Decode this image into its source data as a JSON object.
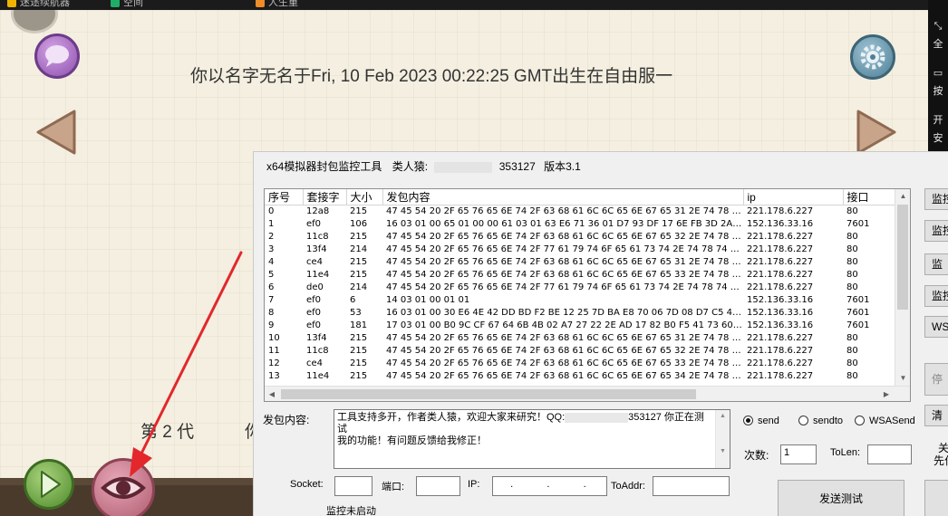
{
  "browser": {
    "tabs": [
      {
        "label": "迷途续航器",
        "color": "#f0b400"
      },
      {
        "label": "空间",
        "color": "#1fae65"
      },
      {
        "label": "人生重",
        "color": "#f08c2a"
      }
    ]
  },
  "right_sidebar": {
    "items": [
      "全",
      "按",
      "开",
      "安"
    ]
  },
  "game": {
    "headline": "你以名字无名于Fri, 10 Feb 2023 00:22:25 GMT出生在自由服一",
    "generation": "第 2 代",
    "generation_suffix": "你"
  },
  "tool": {
    "title_prefix": "x64模拟器封包监控工具",
    "author_label": "类人猿:",
    "author_suffix": "353127",
    "version": "版本3.1",
    "columns": [
      "序号",
      "套接字",
      "大小",
      "发包内容",
      "ip",
      "接口"
    ],
    "rows": [
      [
        "0",
        "12a8",
        "215",
        "47 45 54 20 2F 65 76 65 6E 74 2F 63 68 61 6C 6C 65 6E 67 65 31 2E 74 78 74...",
        "221.178.6.227",
        "80"
      ],
      [
        "1",
        "ef0",
        "106",
        "16 03 01 00 65 01 00 00 61 03 01 63 E6 71 36 01 D7 93 DF 17 6E FB 3D 2A 33...",
        "152.136.33.16",
        "7601"
      ],
      [
        "2",
        "11c8",
        "215",
        "47 45 54 20 2F 65 76 65 6E 74 2F 63 68 61 6C 6C 65 6E 67 65 32 2E 74 78 74...",
        "221.178.6.227",
        "80"
      ],
      [
        "3",
        "13f4",
        "214",
        "47 45 54 20 2F 65 76 65 6E 74 2F 77 61 79 74 6F 65 61 73 74 2E 74 78 74 20...",
        "221.178.6.227",
        "80"
      ],
      [
        "4",
        "ce4",
        "215",
        "47 45 54 20 2F 65 76 65 6E 74 2F 63 68 61 6C 6C 65 6E 67 65 31 2E 74 78 74...",
        "221.178.6.227",
        "80"
      ],
      [
        "5",
        "11e4",
        "215",
        "47 45 54 20 2F 65 76 65 6E 74 2F 63 68 61 6C 6C 65 6E 67 65 33 2E 74 78 74...",
        "221.178.6.227",
        "80"
      ],
      [
        "6",
        "de0",
        "214",
        "47 45 54 20 2F 65 76 65 6E 74 2F 77 61 79 74 6F 65 61 73 74 2E 74 78 74 20...",
        "221.178.6.227",
        "80"
      ],
      [
        "7",
        "ef0",
        "6",
        "14 03 01 00 01 01",
        "152.136.33.16",
        "7601"
      ],
      [
        "8",
        "ef0",
        "53",
        "16 03 01 00 30 E6 4E 42 DD BD F2 BE 12 25 7D BA E8 70 06 7D 08 D7 C5 47 E...",
        "152.136.33.16",
        "7601"
      ],
      [
        "9",
        "ef0",
        "181",
        "17 03 01 00 B0 9C CF 67 64 6B 4B 02 A7 27 22 2E AD 17 82 B0 F5 41 73 60 7...",
        "152.136.33.16",
        "7601"
      ],
      [
        "10",
        "13f4",
        "215",
        "47 45 54 20 2F 65 76 65 6E 74 2F 63 68 61 6C 6C 65 6E 67 65 31 2E 74 78 74...",
        "221.178.6.227",
        "80"
      ],
      [
        "11",
        "11c8",
        "215",
        "47 45 54 20 2F 65 76 65 6E 74 2F 63 68 61 6C 6C 65 6E 67 65 32 2E 74 78 74...",
        "221.178.6.227",
        "80"
      ],
      [
        "12",
        "ce4",
        "215",
        "47 45 54 20 2F 65 76 65 6E 74 2F 63 68 61 6C 6C 65 6E 67 65 33 2E 74 78 74...",
        "221.178.6.227",
        "80"
      ],
      [
        "13",
        "11e4",
        "215",
        "47 45 54 20 2F 65 76 65 6E 74 2F 63 68 61 6C 6C 65 6E 67 65 34 2E 74 78 74...",
        "221.178.6.227",
        "80"
      ]
    ],
    "content_label": "发包内容:",
    "content_text_1": "工具支持多开，作者类人猿，欢迎大家来研究！QQ:",
    "content_text_2": "353127 你正在测试",
    "content_text_3": "我的功能！有问题反馈给我修正！",
    "radios": {
      "send": "send",
      "sendto": "sendto",
      "wsasend": "WSASend",
      "selected": "send"
    },
    "count_label": "次数:",
    "count_value": "1",
    "tolen_label": "ToLen:",
    "tolen_value": "",
    "socket_label": "Socket:",
    "port_label": "端口:",
    "ip_label": "IP:",
    "ip_value": "  .    .    .  ",
    "toaddr_label": "ToAddr:",
    "send_test_label": "发送测试",
    "status": "监控未启动",
    "side_buttons": [
      "监控",
      "监控",
      "监",
      "监控",
      "WSA",
      "停",
      "清"
    ],
    "side_text_1": "关",
    "side_text_2": "先付"
  }
}
